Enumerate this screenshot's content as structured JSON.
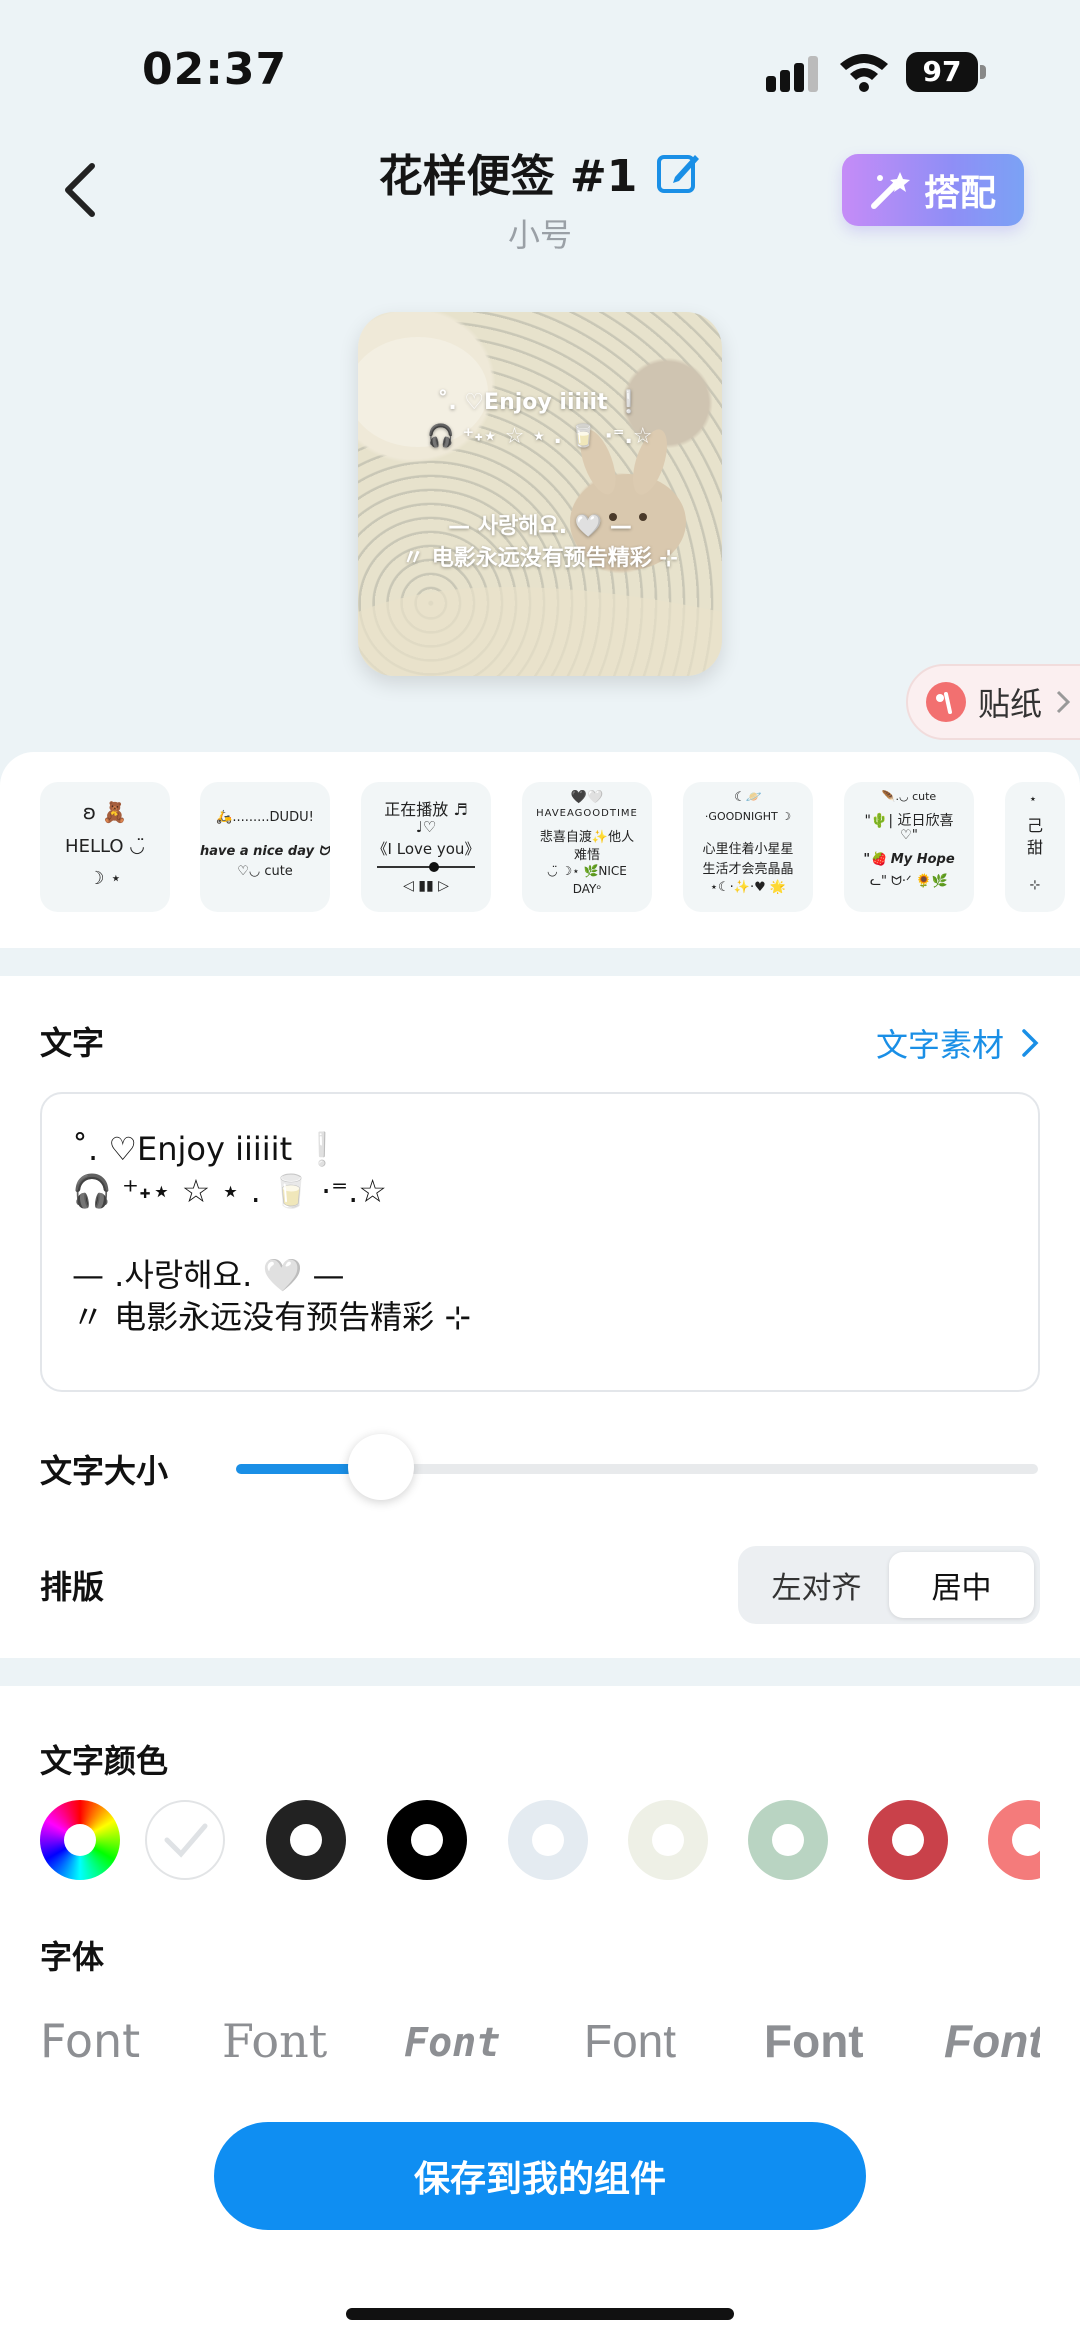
{
  "status": {
    "time": "02:37",
    "battery": "97",
    "icons": [
      "signal-icon",
      "wifi-icon",
      "battery-icon"
    ]
  },
  "header": {
    "title": "花样便签 #1",
    "subtitle": "小号",
    "match_label": "搭配",
    "icons": [
      "chevron-left-icon",
      "edit-icon",
      "magic-wand-icon"
    ]
  },
  "preview": {
    "lines": [
      "˚. ♡Enjoy iiiiit ❕",
      "🎧 ⁺˖⋆ ☆ ⋆ . 🥛 ·⁼.☆",
      "— 사랑해요. 🤍 —",
      "〃 电影永远没有预告精彩 ⊹"
    ]
  },
  "sticker": {
    "label": "贴纸"
  },
  "templates": [
    {
      "lines": [
        "ʚ 🧸",
        "HELLO ◡̈",
        "☽ ⋆"
      ]
    },
    {
      "lines": [
        "🛵.........DUDU!",
        "have a nice day ᗢ·ᐟ",
        "♡◡ cute"
      ]
    },
    {
      "lines": [
        "正在播放 ♬",
        "♩♡",
        "《I Love you》",
        "◁ ▮▮ ▷"
      ]
    },
    {
      "lines": [
        "🖤🤍",
        "HAVEAGOODTIME",
        "悲喜自渡✨他人",
        "难悟",
        "◡̈ ☽⋆ 🌿NICE",
        "DAYᵒ"
      ]
    },
    {
      "lines": [
        "☾🪐",
        "·GOODNIGHT ☽",
        "心里住着小星星",
        "生活才会亮晶晶",
        "⋆☾·✨·♥ 🌟"
      ]
    },
    {
      "lines": [
        "🪶.◡ cute",
        "\"🌵| 近日欣喜",
        "♡\"",
        "\"🍓 My Hope",
        "ᓚ\" ᗢ·ᐟ 🌻🌿"
      ]
    },
    {
      "lines": [
        "⋆ ",
        "己",
        "甜",
        "",
        "⊹"
      ]
    }
  ],
  "text_section": {
    "label": "文字",
    "material_link": "文字素材",
    "content": "˚. ♡Enjoy iiiiit ❕\n🎧 ⁺˖⋆ ☆ ⋆ . 🥛 ·⁼.☆\n\n— .사랑해요. 🤍 —\n〃 电影永远没有预告精彩 ⊹",
    "size_label": "文字大小",
    "size_value": 0.12,
    "layout_label": "排版",
    "align_options": [
      "左对齐",
      "居中"
    ],
    "align_selected": "居中"
  },
  "color_section": {
    "label": "文字颜色",
    "swatches": [
      "rainbow",
      "#ffffff",
      "#222222",
      "#000000",
      "#e4ebf1",
      "#eef0e6",
      "#b9d4c2",
      "#c9414a",
      "#f47b7b"
    ]
  },
  "font_section": {
    "label": "字体",
    "samples": [
      "Font",
      "Font",
      "Font",
      "Font",
      "Font",
      "Font"
    ]
  },
  "save_button": "保存到我的组件"
}
